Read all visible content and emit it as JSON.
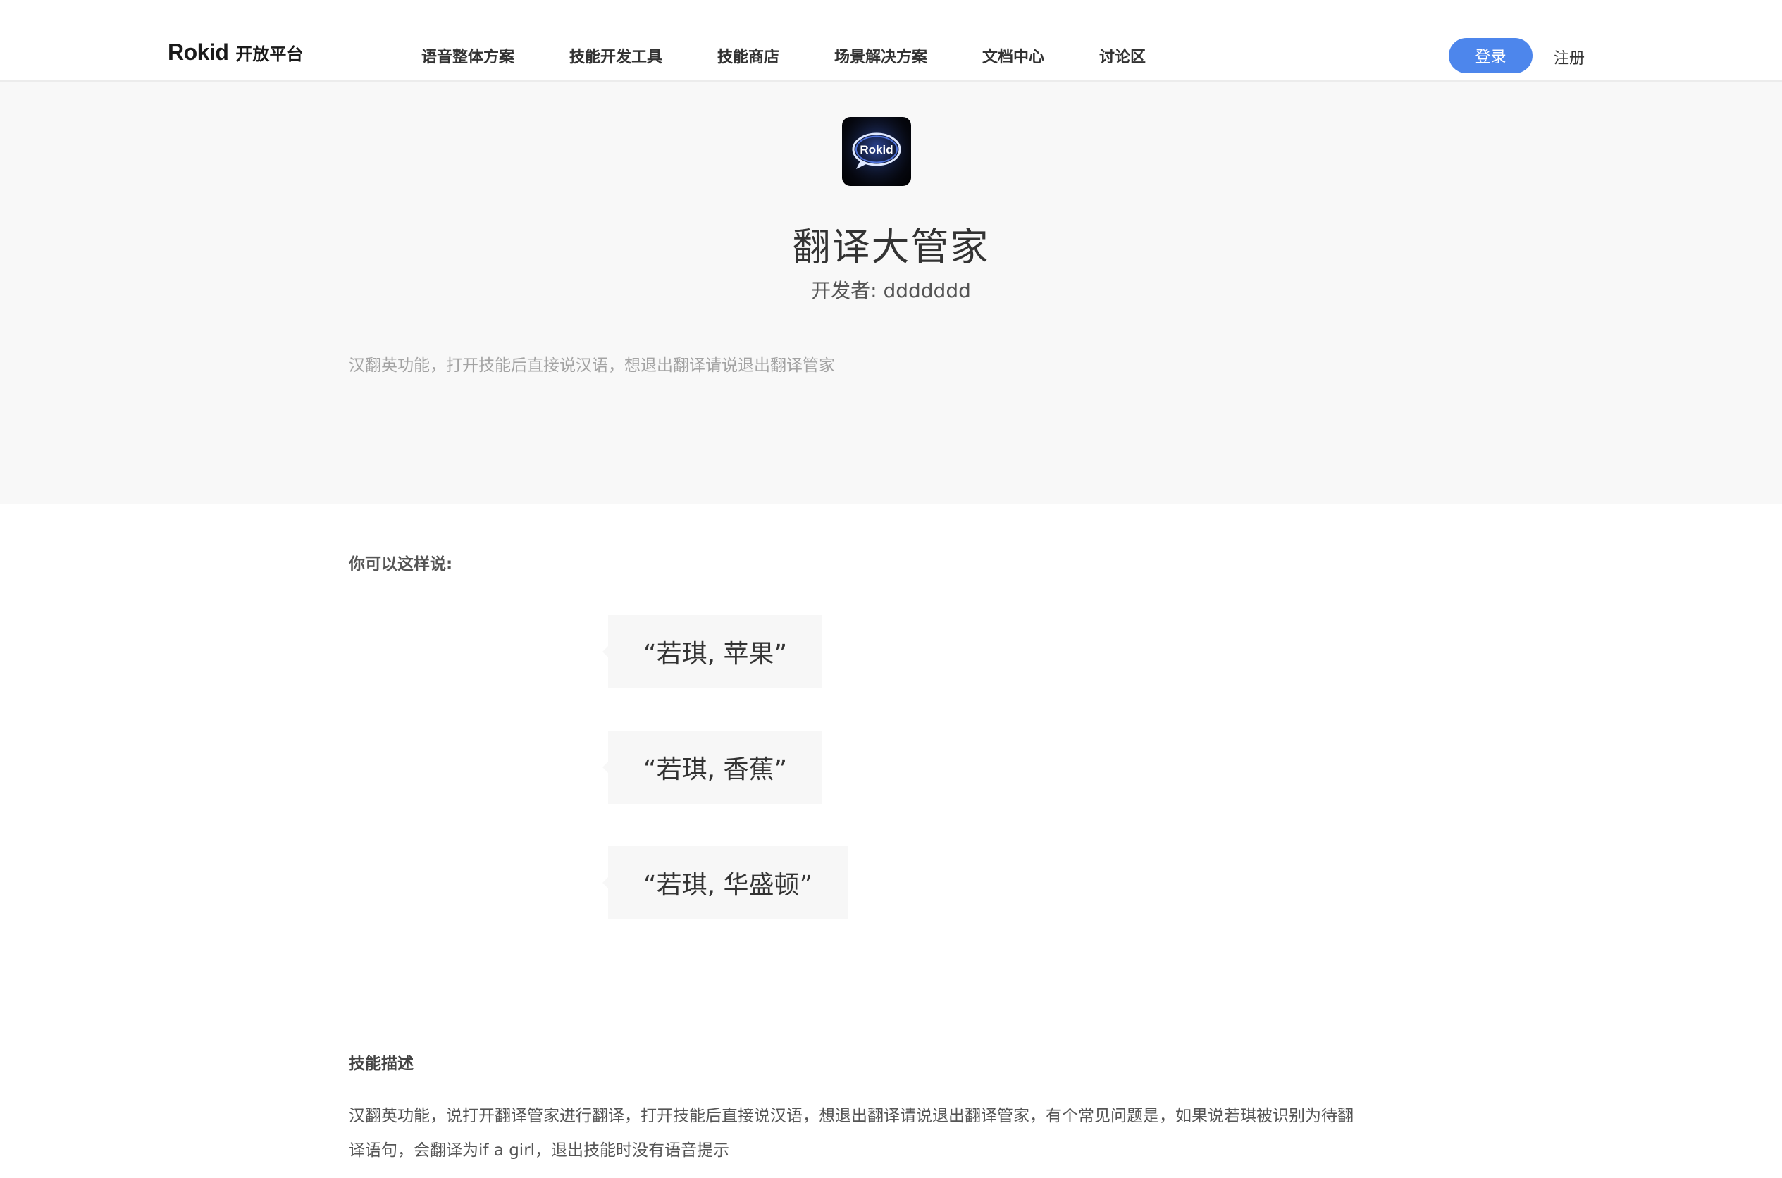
{
  "header": {
    "logo_wordmark": "Rokid",
    "logo_suffix": "开放平台",
    "nav": [
      {
        "label": "语音整体方案",
        "active": false
      },
      {
        "label": "技能开发工具",
        "active": false
      },
      {
        "label": "技能商店",
        "active": true
      },
      {
        "label": "场景解决方案",
        "active": false
      },
      {
        "label": "文档中心",
        "active": false
      },
      {
        "label": "讨论区",
        "active": false
      }
    ],
    "login_label": "登录",
    "register_label": "注册"
  },
  "hero": {
    "icon_name": "rokid-speech-bubble-icon",
    "icon_text": "Rokid",
    "app_name": "翻译大管家",
    "developer": "开发者: ddddddd",
    "summary": "汉翻英功能，打开技能后直接说汉语，想退出翻译请说退出翻译管家"
  },
  "examples": {
    "title": "你可以这样说:",
    "items": [
      "“若琪, 苹果”",
      "“若琪, 香蕉”",
      "“若琪, 华盛顿”"
    ]
  },
  "description": {
    "title": "技能描述",
    "text_line1": "汉翻英功能，说打开翻译管家进行翻译，打开技能后直接说汉语，想退出翻译请说退出翻译管家，有个常见问题是，如果说若琪被识别为待翻",
    "text_line2": "译语句，会翻译为if a girl，退出技能时没有语音提示"
  },
  "colors": {
    "accent": "#4d86ec",
    "hero_bg": "#f8f8f8",
    "bubble_bg": "#f7f7f7"
  }
}
